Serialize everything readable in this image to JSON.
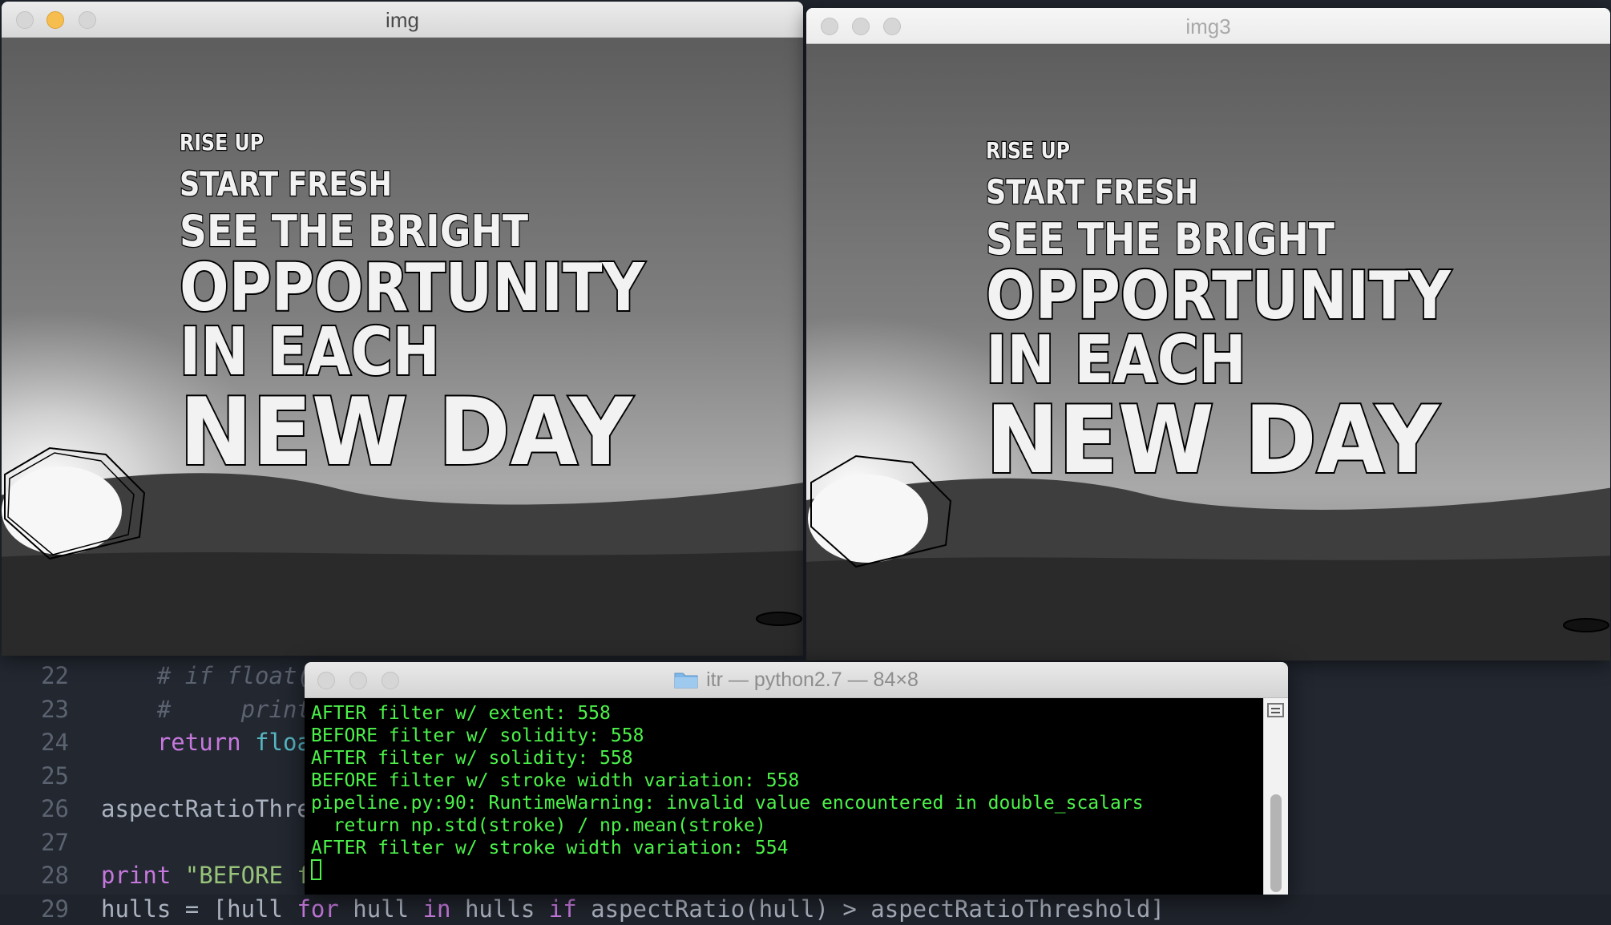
{
  "editor": {
    "lines": [
      {
        "num": "22",
        "tokens": [
          {
            "t": "    # if float(w)/h < aspectRatioThreshold:",
            "c": "comment"
          }
        ]
      },
      {
        "num": "23",
        "tokens": [
          {
            "t": "    #     print",
            "c": "comment"
          }
        ]
      },
      {
        "num": "24",
        "tokens": [
          {
            "t": "    ",
            "c": "plain"
          },
          {
            "t": "return",
            "c": "keyword"
          },
          {
            "t": " ",
            "c": "plain"
          },
          {
            "t": "floa",
            "c": "builtin"
          }
        ]
      },
      {
        "num": "25",
        "tokens": []
      },
      {
        "num": "26",
        "tokens": [
          {
            "t": "aspectRatioThre",
            "c": "plain"
          }
        ]
      },
      {
        "num": "27",
        "tokens": []
      },
      {
        "num": "28",
        "tokens": [
          {
            "t": "print",
            "c": "keyword"
          },
          {
            "t": " ",
            "c": "plain"
          },
          {
            "t": "\"BEFORE f",
            "c": "string"
          }
        ]
      },
      {
        "num": "29",
        "tokens": [
          {
            "t": "hulls = [hull ",
            "c": "plain"
          },
          {
            "t": "for",
            "c": "keyword"
          },
          {
            "t": " hull ",
            "c": "plain"
          },
          {
            "t": "in",
            "c": "keyword"
          },
          {
            "t": " hulls ",
            "c": "plain"
          },
          {
            "t": "if",
            "c": "keyword"
          },
          {
            "t": " aspectRatio(hull) > aspectRatioThreshold]",
            "c": "plain"
          }
        ]
      }
    ]
  },
  "windows": {
    "img": {
      "title": "img"
    },
    "img3": {
      "title": "img3"
    }
  },
  "poster": {
    "lines": [
      "RISE UP",
      "START FRESH",
      "SEE THE BRIGHT",
      "OPPORTUNITY",
      "IN EACH",
      "NEW DAY"
    ]
  },
  "terminal": {
    "title": "itr — python2.7 — 84×8",
    "lines": [
      "AFTER filter w/ extent: 558",
      "BEFORE filter w/ solidity: 558",
      "AFTER filter w/ solidity: 558",
      "BEFORE filter w/ stroke width variation: 558",
      "pipeline.py:90: RuntimeWarning: invalid value encountered in double_scalars",
      "  return np.std(stroke) / np.mean(stroke)",
      "AFTER filter w/ stroke width variation: 554"
    ]
  },
  "colors": {
    "terminal_text": "#4cf24a",
    "editor_bg": "#222730",
    "min_light": "#f5be4f"
  }
}
